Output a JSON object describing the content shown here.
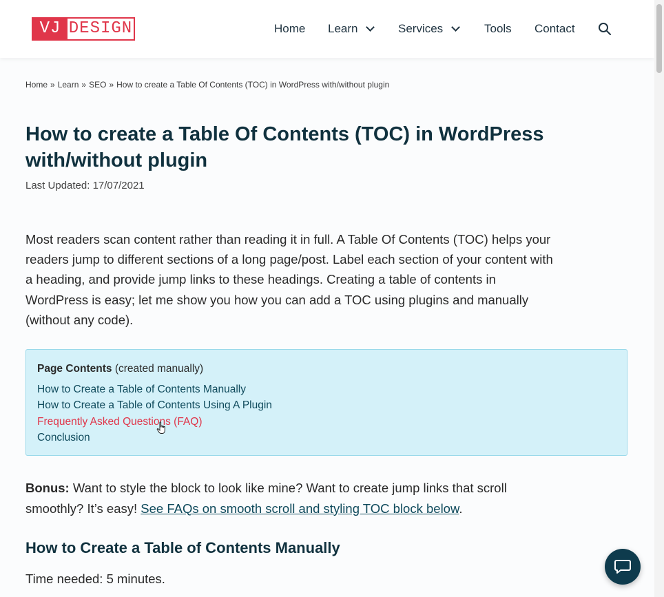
{
  "logo": {
    "left": "VJ",
    "right": "DESIGN"
  },
  "nav": {
    "home": "Home",
    "learn": "Learn",
    "services": "Services",
    "tools": "Tools",
    "contact": "Contact"
  },
  "breadcrumb": {
    "items": [
      "Home",
      "Learn",
      "SEO"
    ],
    "separator": "»",
    "current": "How to create a Table Of Contents (TOC) in WordPress with/without plugin"
  },
  "article": {
    "title": "How to create a Table Of Contents (TOC) in WordPress with/without plugin",
    "last_updated": "Last Updated: 17/07/2021",
    "intro": "Most readers scan content rather than reading it in full. A Table Of Contents (TOC) helps your readers jump to different sections of a long page/post. Label each section of your content with a heading, and provide jump links to these headings. Creating a table of contents in WordPress is easy; let me show you how you can add a TOC using plugins and manually (without any code).",
    "toc": {
      "heading": "Page Contents",
      "note": " (created manually)",
      "links": [
        "How to Create a Table of Contents Manually",
        "How to Create a Table of Contents Using A Plugin",
        "Frequently Asked Questions (FAQ)",
        "Conclusion"
      ]
    },
    "bonus": {
      "label": "Bonus:",
      "text": " Want to style the block to look like mine? Want to create jump links that scroll smoothly? It’s easy! ",
      "link": "See FAQs on smooth scroll and styling TOC block below",
      "end": "."
    },
    "section_heading": "How to Create a Table of Contents Manually",
    "time_needed": "Time needed: 5 minutes."
  },
  "colors": {
    "accent": "#e0364a",
    "heading": "#10313e",
    "toc_bg": "#d4f1f9",
    "link": "#0f4a5c",
    "chat_button": "#0e3b4d"
  },
  "icons": {
    "search": "search-icon",
    "chat": "chat-icon",
    "cursor": "hand-pointer-icon"
  }
}
